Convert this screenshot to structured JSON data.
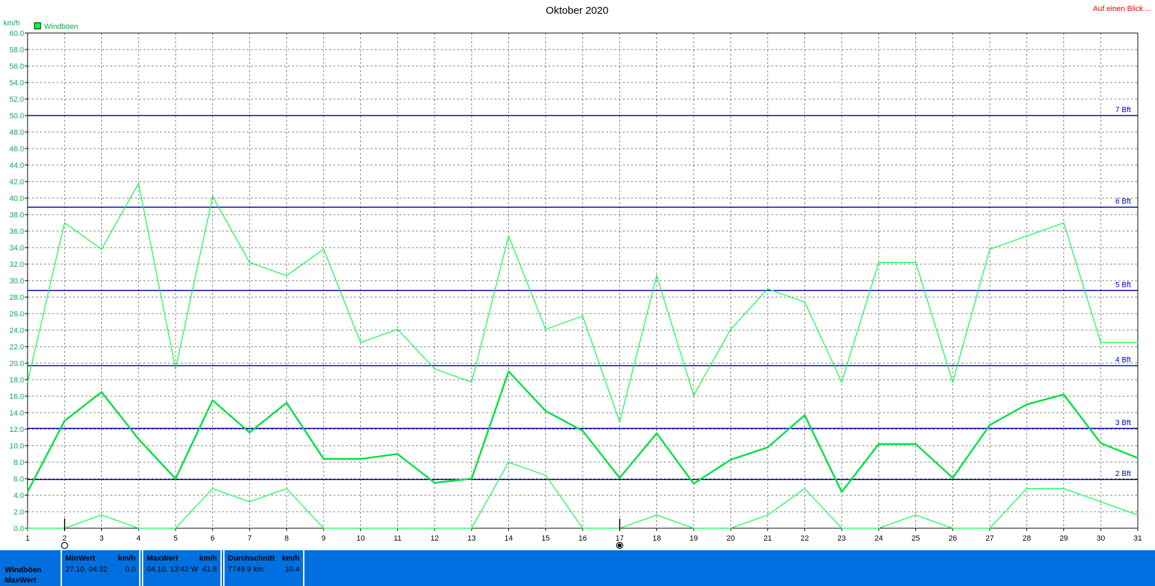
{
  "chart_data": {
    "type": "line",
    "title": "Oktober 2020",
    "ylabel": "km/h",
    "ylim": [
      0,
      60
    ],
    "y_tick_step": 2,
    "x_ticks": [
      1,
      2,
      3,
      4,
      5,
      6,
      7,
      8,
      9,
      10,
      11,
      12,
      13,
      14,
      15,
      16,
      17,
      18,
      19,
      20,
      21,
      22,
      23,
      24,
      25,
      26,
      27,
      28,
      29,
      30,
      31
    ],
    "grid": true,
    "legend": {
      "position": "top-left",
      "entries": [
        {
          "label": "Windböen",
          "color": "#00ff40"
        }
      ]
    },
    "x": [
      1,
      2,
      3,
      4,
      5,
      6,
      7,
      8,
      9,
      10,
      11,
      12,
      13,
      14,
      15,
      16,
      17,
      18,
      19,
      20,
      21,
      22,
      23,
      24,
      25,
      26,
      27,
      28,
      29,
      30,
      31
    ],
    "series": [
      {
        "role": "max",
        "color": "#00ff40",
        "values": [
          17.7,
          37.0,
          33.8,
          41.8,
          19.3,
          40.2,
          32.2,
          30.6,
          33.8,
          22.5,
          24.1,
          19.3,
          17.7,
          35.4,
          24.1,
          25.7,
          12.9,
          30.6,
          16.1,
          24.1,
          29.0,
          27.4,
          17.7,
          32.2,
          32.2,
          17.7,
          33.8,
          35.4,
          37.0,
          22.5,
          22.5
        ]
      },
      {
        "role": "avg",
        "color": "#00e040",
        "values": [
          4.4,
          13.0,
          16.5,
          10.8,
          6.0,
          15.5,
          11.6,
          15.2,
          8.4,
          8.4,
          9.0,
          5.5,
          6.0,
          19.0,
          14.2,
          11.8,
          6.1,
          11.5,
          5.4,
          8.3,
          9.8,
          13.7,
          4.4,
          10.2,
          10.2,
          6.1,
          12.5,
          15.0,
          16.2,
          10.3,
          8.5
        ]
      },
      {
        "role": "min",
        "color": "#00ff40",
        "values": [
          0.0,
          0.0,
          1.6,
          0.0,
          0.0,
          4.8,
          3.2,
          4.8,
          0.0,
          0.0,
          0.0,
          0.0,
          0.0,
          8.0,
          6.4,
          0.0,
          0.0,
          1.6,
          0.0,
          0.0,
          1.6,
          4.8,
          0.0,
          0.0,
          1.6,
          0.0,
          0.0,
          4.8,
          4.8,
          3.2,
          1.6
        ]
      }
    ],
    "reference_lines": [
      {
        "value": 5.9,
        "label": "2 Bft"
      },
      {
        "value": 12.1,
        "label": "3 Bft"
      },
      {
        "value": 19.7,
        "label": "4 Bft"
      },
      {
        "value": 28.8,
        "label": "5 Bft"
      },
      {
        "value": 38.9,
        "label": "6 Bft"
      },
      {
        "value": 50.0,
        "label": "7 Bft"
      }
    ],
    "markers": [
      {
        "x": 2,
        "kind": "new-moon"
      },
      {
        "x": 17,
        "kind": "full-moon"
      }
    ],
    "axis_color": "#000000",
    "grid_color": "#808080",
    "ref_line_color": "#0000c0"
  },
  "header": {
    "link": "Auf einen Blick ..."
  },
  "stats": {
    "row_labels": [
      "Windböen",
      "MaxWert"
    ],
    "boxes": [
      {
        "head": "MinWert",
        "unit": "km/h",
        "left": "27.10.  04:32",
        "right": "0.0"
      },
      {
        "head": "MaxWert",
        "unit": "km/h",
        "left": "04.10.  13:42  W",
        "right": "41.8"
      },
      {
        "head": "Durchschnitt",
        "unit": "km/h",
        "left": "7749.9 km",
        "right": "10.4"
      }
    ],
    "bar_color": "#0070e0"
  }
}
